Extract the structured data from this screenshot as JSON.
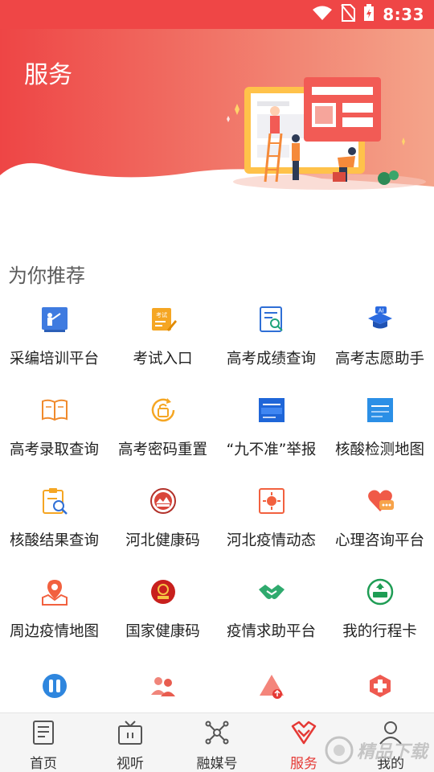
{
  "status_bar": {
    "time": "8:33"
  },
  "header": {
    "title": "服务"
  },
  "section": {
    "title": "为你推荐"
  },
  "services": [
    {
      "label": "采编培训平台",
      "icon": "training-icon"
    },
    {
      "label": "考试入口",
      "icon": "exam-icon"
    },
    {
      "label": "高考成绩查询",
      "icon": "score-query-icon"
    },
    {
      "label": "高考志愿助手",
      "icon": "ai-graduation-icon"
    },
    {
      "label": "高考录取查询",
      "icon": "open-book-icon"
    },
    {
      "label": "高考密码重置",
      "icon": "lock-reset-icon"
    },
    {
      "label": "“九不准”举报",
      "icon": "report-banner-icon"
    },
    {
      "label": "核酸检测地图",
      "icon": "test-map-banner-icon"
    },
    {
      "label": "核酸结果查询",
      "icon": "result-search-icon"
    },
    {
      "label": "河北健康码",
      "icon": "hebei-emblem-icon"
    },
    {
      "label": "河北疫情动态",
      "icon": "virus-news-icon"
    },
    {
      "label": "心理咨询平台",
      "icon": "heart-chat-icon"
    },
    {
      "label": "周边疫情地图",
      "icon": "location-map-icon"
    },
    {
      "label": "国家健康码",
      "icon": "national-emblem-icon"
    },
    {
      "label": "疫情求助平台",
      "icon": "handshake-icon"
    },
    {
      "label": "我的行程卡",
      "icon": "travel-card-icon"
    },
    {
      "label": "",
      "icon": "medical-vial-icon"
    },
    {
      "label": "",
      "icon": "people-icon"
    },
    {
      "label": "",
      "icon": "warning-triangle-icon"
    },
    {
      "label": "",
      "icon": "medical-cross-icon"
    }
  ],
  "tabs": [
    {
      "label": "首页",
      "icon": "news-icon",
      "active": false
    },
    {
      "label": "视听",
      "icon": "tv-icon",
      "active": false
    },
    {
      "label": "融媒号",
      "icon": "network-icon",
      "active": false
    },
    {
      "label": "服务",
      "icon": "service-heart-icon",
      "active": true
    },
    {
      "label": "我的",
      "icon": "user-icon",
      "active": false
    }
  ],
  "colors": {
    "brand_red": "#ef4646",
    "active_tab": "#e53935"
  },
  "watermark": {
    "text": "精品下载"
  }
}
